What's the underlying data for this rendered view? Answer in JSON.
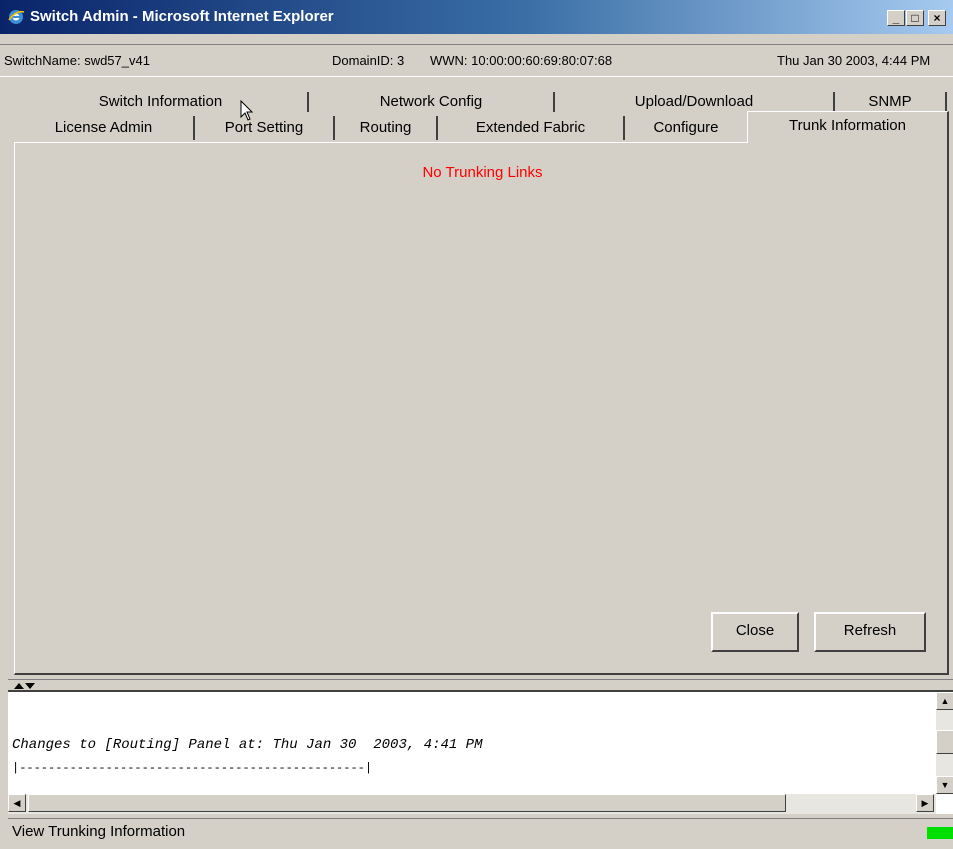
{
  "window": {
    "title": "Switch Admin - Microsoft Internet Explorer",
    "buttons": {
      "minimize": "_",
      "maximize": "□",
      "close": "×"
    }
  },
  "info_bar": {
    "switch_name": "SwitchName: swd57_v41",
    "domain_id": "DomainID: 3",
    "wwn": "WWN: 10:00:00:60:69:80:07:68",
    "datetime": "Thu Jan 30  2003, 4:44 PM"
  },
  "tabs_row1": [
    "Switch Information",
    "Network Config",
    "Upload/Download",
    "SNMP"
  ],
  "tabs_row2": [
    "License Admin",
    "Port Setting",
    "Routing",
    "Extended Fabric",
    "Configure",
    "Trunk Information"
  ],
  "active_tab": "Trunk Information",
  "panel": {
    "message": "No Trunking Links",
    "message_color": "#ff0000",
    "close_label": "Close",
    "refresh_label": "Refresh"
  },
  "log": {
    "line1": "Changes to [Routing] Panel at: Thu Jan 30  2003, 4:41 PM",
    "line2": "|------------------------------------------------|"
  },
  "status": {
    "text": "View Trunking Information",
    "indicator_color": "#00e000"
  }
}
